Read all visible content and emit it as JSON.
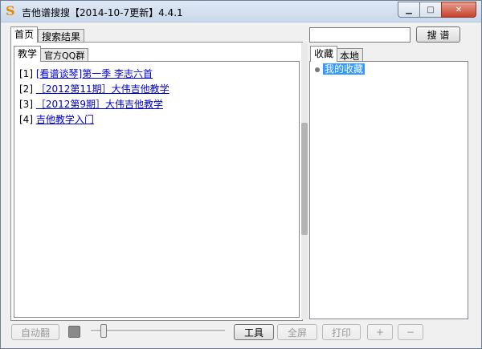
{
  "window": {
    "title": "吉他谱搜搜【2014-10-7更新】4.4.1",
    "minimize_glyph": "▁",
    "maximize_glyph": "□",
    "close_glyph": "✕"
  },
  "left_tabs": [
    "首页",
    "搜索结果"
  ],
  "sub_tabs": [
    "教学",
    "官方QQ群"
  ],
  "teaching_items": [
    {
      "index": "[1]",
      "text": "[看谱谈琴]第一季 李志六首"
    },
    {
      "index": "[2]",
      "text": "［2012第11期］大伟吉他教学"
    },
    {
      "index": "[3]",
      "text": "［2012第9期］大伟吉他教学"
    },
    {
      "index": "[4]",
      "text": "吉他教学入门"
    }
  ],
  "search": {
    "value": "",
    "button": "搜 谱"
  },
  "right_tabs": [
    "收藏",
    "本地"
  ],
  "favorites": [
    {
      "label": "我的收藏"
    }
  ],
  "bottom": {
    "auto_flip": "自动翻",
    "tools": "工具",
    "fullscreen": "全屏",
    "print": "打印",
    "zoom_in": "+",
    "zoom_out": "−",
    "speed_level": 0.1
  }
}
